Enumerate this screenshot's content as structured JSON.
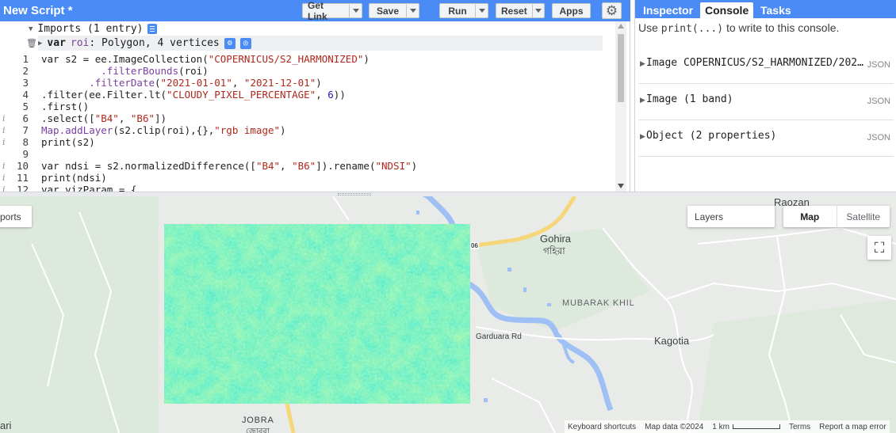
{
  "toolbar": {
    "title": "New Script *",
    "get_link": "Get Link",
    "save": "Save",
    "run": "Run",
    "reset": "Reset",
    "apps": "Apps",
    "settings_icon": "gear-icon"
  },
  "imports": {
    "header": "Imports (1 entry)",
    "var_keyword": "var",
    "var_name": "roi",
    "var_desc": ": Polygon, 4 vertices"
  },
  "code_lines": [
    {
      "n": "1",
      "info": "",
      "text": "var s2 = ee.ImageCollection(\"COPERNICUS/S2_HARMONIZED\")"
    },
    {
      "n": "2",
      "info": "",
      "text": "          .filterBounds(roi)"
    },
    {
      "n": "3",
      "info": "",
      "text": "        .filterDate(\"2021-01-01\", \"2021-12-01\")"
    },
    {
      "n": "4",
      "info": "",
      "text": ".filter(ee.Filter.lt(\"CLOUDY_PIXEL_PERCENTAGE\", 6))"
    },
    {
      "n": "5",
      "info": "",
      "text": ".first()"
    },
    {
      "n": "6",
      "info": "i",
      "text": ".select([\"B4\", \"B6\"])"
    },
    {
      "n": "7",
      "info": "i",
      "text": "Map.addLayer(s2.clip(roi),{},\"rgb image\")"
    },
    {
      "n": "8",
      "info": "i",
      "text": "print(s2)"
    },
    {
      "n": "9",
      "info": "",
      "text": ""
    },
    {
      "n": "10",
      "info": "i",
      "text": "var ndsi = s2.normalizedDifference([\"B4\", \"B6\"]).rename(\"NDSI\")"
    },
    {
      "n": "11",
      "info": "i",
      "text": "print(ndsi)"
    },
    {
      "n": "12",
      "info": "i",
      "text": "var vizParam = {"
    }
  ],
  "console": {
    "tabs": [
      "Inspector",
      "Console",
      "Tasks"
    ],
    "active_tab": "Console",
    "hint_prefix": "Use ",
    "hint_code": "print(...)",
    "hint_suffix": " to write to this console.",
    "entries": [
      {
        "text": "Image COPERNICUS/S2_HARMONIZED/2021...",
        "json": "JSON"
      },
      {
        "text": "Image (1 band)",
        "json": "JSON"
      },
      {
        "text": "Object (2 properties)",
        "json": "JSON"
      }
    ]
  },
  "map": {
    "imports_chip": "ports",
    "layers": "Layers",
    "map_type": [
      "Map",
      "Satellite"
    ],
    "active_map_type": "Map",
    "labels": {
      "raozan": "Raozan",
      "gohira": "Gohira",
      "gohira_bn": "গহিরা",
      "mubarak_khil": "MUBARAK KHIL",
      "kagotia": "Kagotia",
      "garduara_rd": "Garduara Rd",
      "jobra": "JOBRA",
      "jobra_bn": "জোবরা",
      "road_06": "06",
      "edge_left": "ari"
    },
    "footer": {
      "shortcuts": "Keyboard shortcuts",
      "map_data": "Map data ©2024",
      "scale": "1 km",
      "terms": "Terms",
      "report": "Report a map error"
    }
  }
}
